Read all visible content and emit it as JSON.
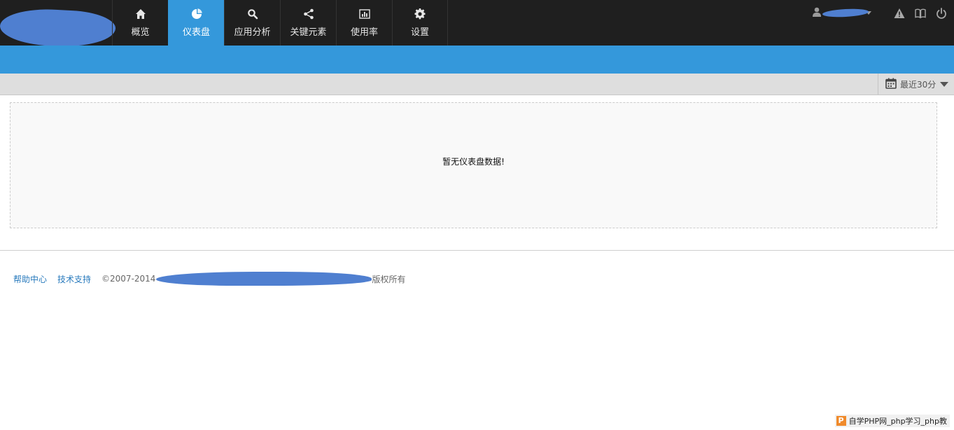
{
  "nav": {
    "items": [
      {
        "label": "概览",
        "icon": "home-icon"
      },
      {
        "label": "仪表盘",
        "icon": "pie-chart-icon",
        "active": true
      },
      {
        "label": "应用分析",
        "icon": "search-icon"
      },
      {
        "label": "关键元素",
        "icon": "share-icon"
      },
      {
        "label": "使用率",
        "icon": "bar-chart-icon"
      },
      {
        "label": "设置",
        "icon": "gear-icon"
      }
    ]
  },
  "toolbar": {
    "icons": [
      "warning-icon",
      "book-icon",
      "power-icon"
    ]
  },
  "time_range": {
    "label": "最近30分",
    "icon": "calendar-icon"
  },
  "dashboard": {
    "empty_message": "暂无仪表盘数据!"
  },
  "footer": {
    "help_link": "帮助中心",
    "support_link": "技术支持",
    "copyright_prefix": "©2007-2014",
    "copyright_suffix": "版权所有"
  },
  "watermark": {
    "logo": "P",
    "text": "自学PHP网_php学习_php教"
  },
  "colors": {
    "topbar": "#1f1f1f",
    "accent": "#3498db",
    "link": "#2a7bbd"
  }
}
